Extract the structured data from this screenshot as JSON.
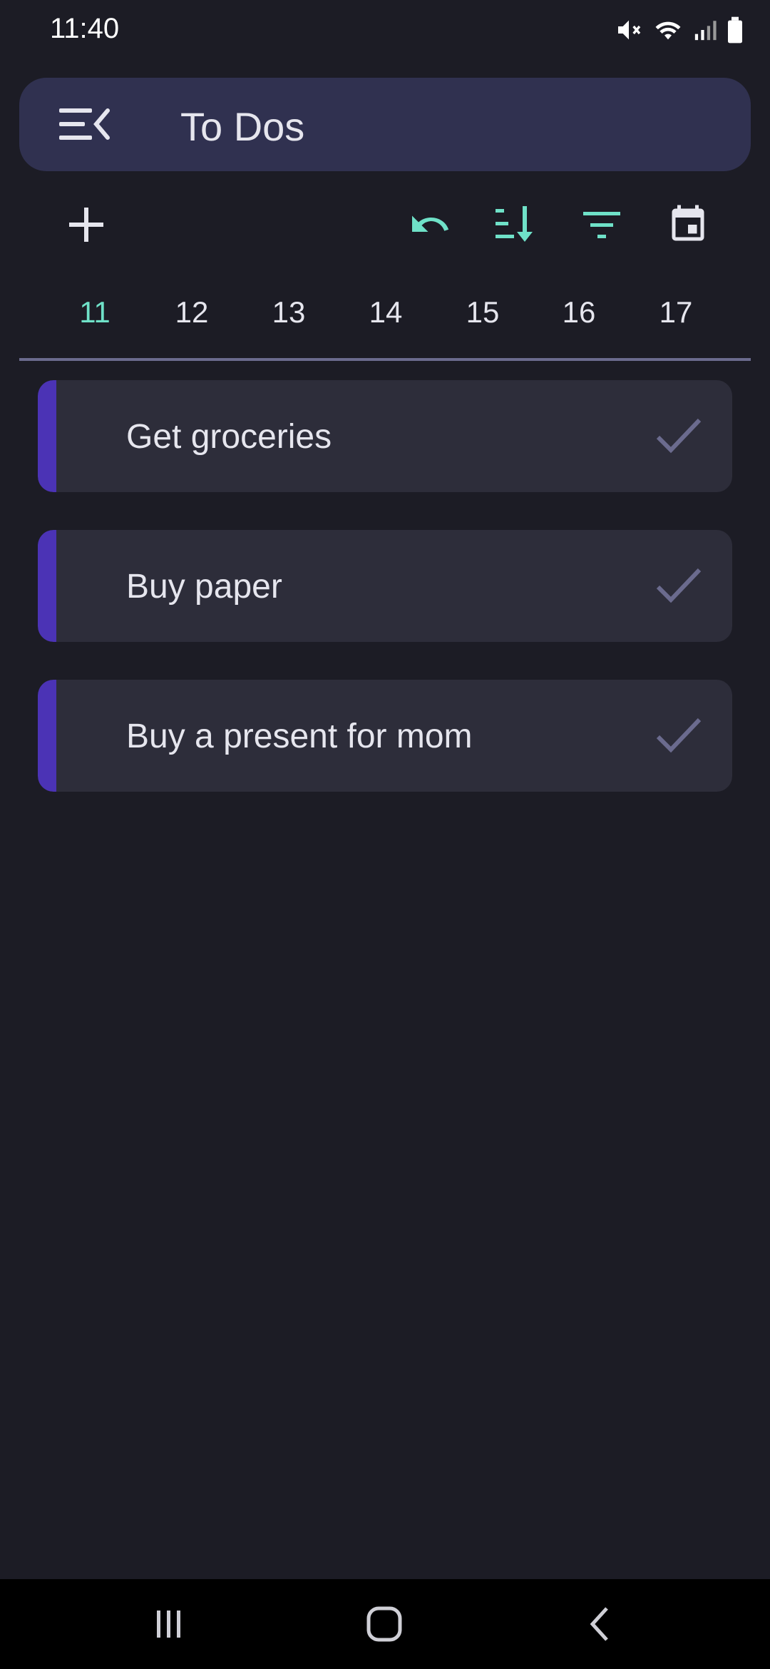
{
  "status_bar": {
    "time": "11:40",
    "icons": [
      "mute-icon",
      "wifi-icon",
      "signal-icon",
      "battery-icon"
    ]
  },
  "app_bar": {
    "title": "To Dos",
    "menu_icon": "menu-collapse-icon"
  },
  "toolbar": {
    "buttons": [
      "add-icon",
      "undo-icon",
      "sort-icon",
      "filter-icon",
      "calendar-icon"
    ]
  },
  "days": [
    "11",
    "12",
    "13",
    "14",
    "15",
    "16",
    "17"
  ],
  "selected_day": "11",
  "todos": [
    {
      "label": "Get groceries"
    },
    {
      "label": "Buy paper"
    },
    {
      "label": "Buy a present for mom"
    }
  ],
  "colors": {
    "background": "#1c1c25",
    "app_bar": "#303150",
    "accent_teal": "#6fe1c8",
    "todo_card": "#2d2d3a",
    "todo_accent": "#4b33b5",
    "check_color": "#6b6b8e"
  },
  "nav_bar": {
    "buttons": [
      "recents-icon",
      "home-icon",
      "back-icon"
    ]
  }
}
